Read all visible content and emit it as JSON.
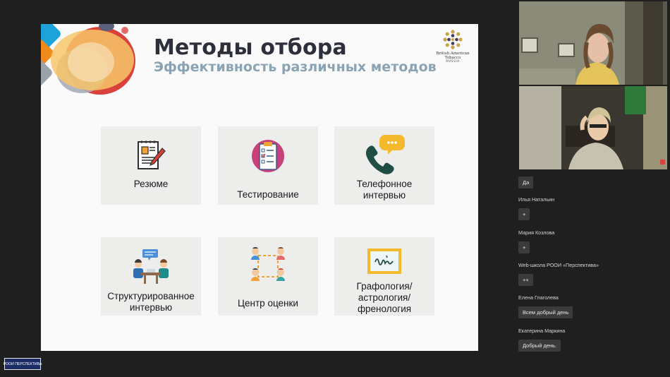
{
  "slide": {
    "title": "Методы отбора",
    "subtitle": "Эффективность различных методов",
    "brand": {
      "name": "British American\nTobacco",
      "country": "RUSSIA"
    },
    "cards": [
      {
        "label": "Резюме",
        "icon": "resume-icon"
      },
      {
        "label": "Тестирование",
        "icon": "test-clipboard-icon"
      },
      {
        "label": "Телефонное\nинтервью",
        "icon": "phone-icon"
      },
      {
        "label": "Структурированное\nинтервью",
        "icon": "interview-icon"
      },
      {
        "label": "Центр оценки",
        "icon": "assessment-center-icon"
      },
      {
        "label": "Графология/\nастрология/\nфренология",
        "icon": "handwriting-icon"
      }
    ]
  },
  "chat": {
    "messages": [
      {
        "author": "",
        "text": "Да"
      },
      {
        "author": "Илья Натальин",
        "text": "+"
      },
      {
        "author": "Мария Козлова",
        "text": "+"
      },
      {
        "author": "Web-школа РООИ «Перспектива»",
        "text": "++"
      },
      {
        "author": "Елена Глаголева",
        "text": "Всем добрый день"
      },
      {
        "author": "Екатерина Маркина",
        "text": "Добрый день."
      }
    ]
  },
  "badge": {
    "label": "РООИ ПЕРСПЕКТИВА"
  },
  "colors": {
    "accent_red": "#d9413a",
    "accent_orange": "#f2a23a",
    "accent_blue": "#1da3d8",
    "subtitle": "#8aa3b4"
  }
}
